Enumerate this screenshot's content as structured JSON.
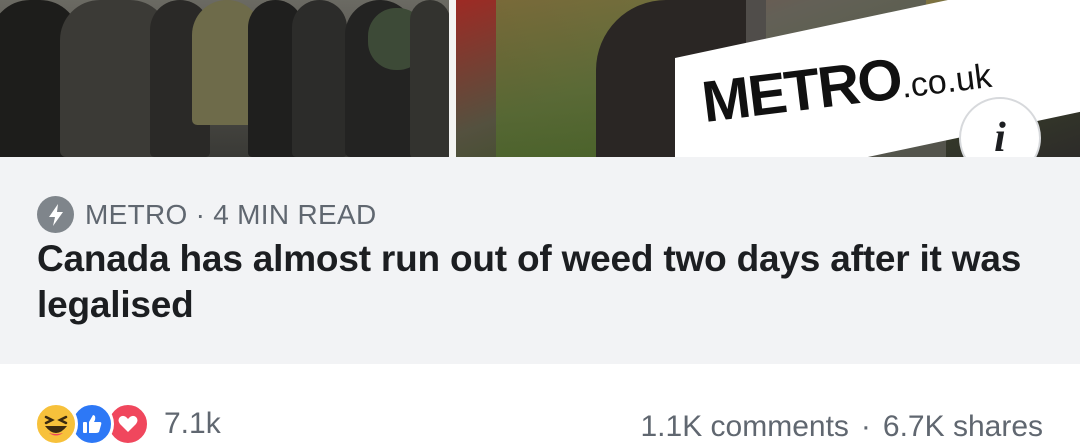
{
  "hero": {
    "logo_main": "METRO",
    "logo_domain": ".co.uk"
  },
  "link": {
    "source": "METRO",
    "separator": "·",
    "read_time": "4 MIN READ",
    "headline": "Canada has almost run out of weed two days after it was legalised"
  },
  "reactions": {
    "types": [
      "haha",
      "like",
      "love"
    ],
    "count": "7.1k"
  },
  "stats": {
    "comments": "1.1K comments",
    "separator": "·",
    "shares": "6.7K shares"
  },
  "colors": {
    "caption_bg": "#f2f3f5",
    "text_primary": "#1c1e21",
    "text_secondary": "#606770",
    "like_blue": "#2d78f6",
    "love_red": "#f0475d",
    "haha_yellow": "#f7c13b"
  }
}
